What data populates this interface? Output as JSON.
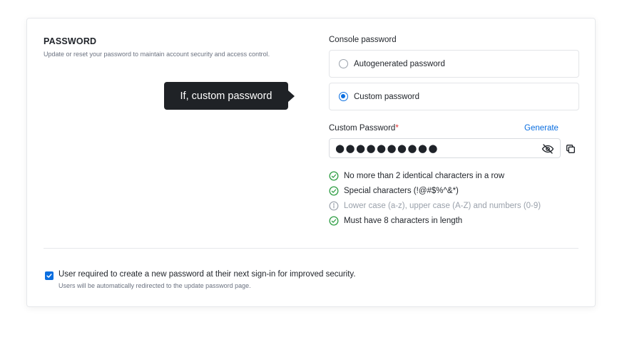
{
  "section": {
    "title": "PASSWORD",
    "description": "Update or reset your password to maintain account security and access control."
  },
  "tooltip": {
    "text": "If, custom password"
  },
  "console_password": {
    "label": "Console password",
    "options": [
      {
        "label": "Autogenerated password",
        "selected": false
      },
      {
        "label": "Custom password",
        "selected": true
      }
    ]
  },
  "custom_password": {
    "label": "Custom Password",
    "required_mark": "*",
    "generate_label": "Generate",
    "masked_value": "●●●●●●●●●●"
  },
  "rules": [
    {
      "text": "No more than 2 identical characters in a row",
      "status": "ok"
    },
    {
      "text": "Special characters (!@#$%^&*)",
      "status": "ok"
    },
    {
      "text": "Lower case (a-z), upper case (A-Z) and numbers (0-9)",
      "status": "info"
    },
    {
      "text": "Must have 8 characters in length",
      "status": "ok"
    }
  ],
  "force_reset": {
    "checked": true,
    "label": "User required to create a new password at their next sign-in for improved security.",
    "sublabel": "Users will be automatically redirected to the update password page."
  },
  "colors": {
    "accent": "#0a6ee0",
    "success": "#2f9e44",
    "muted": "#9aa1ab",
    "tooltip_bg": "#1f2226"
  },
  "icons": {
    "visibility": "eye-off-icon",
    "copy": "copy-icon",
    "ok": "check-circle-icon",
    "info": "info-circle-icon"
  }
}
